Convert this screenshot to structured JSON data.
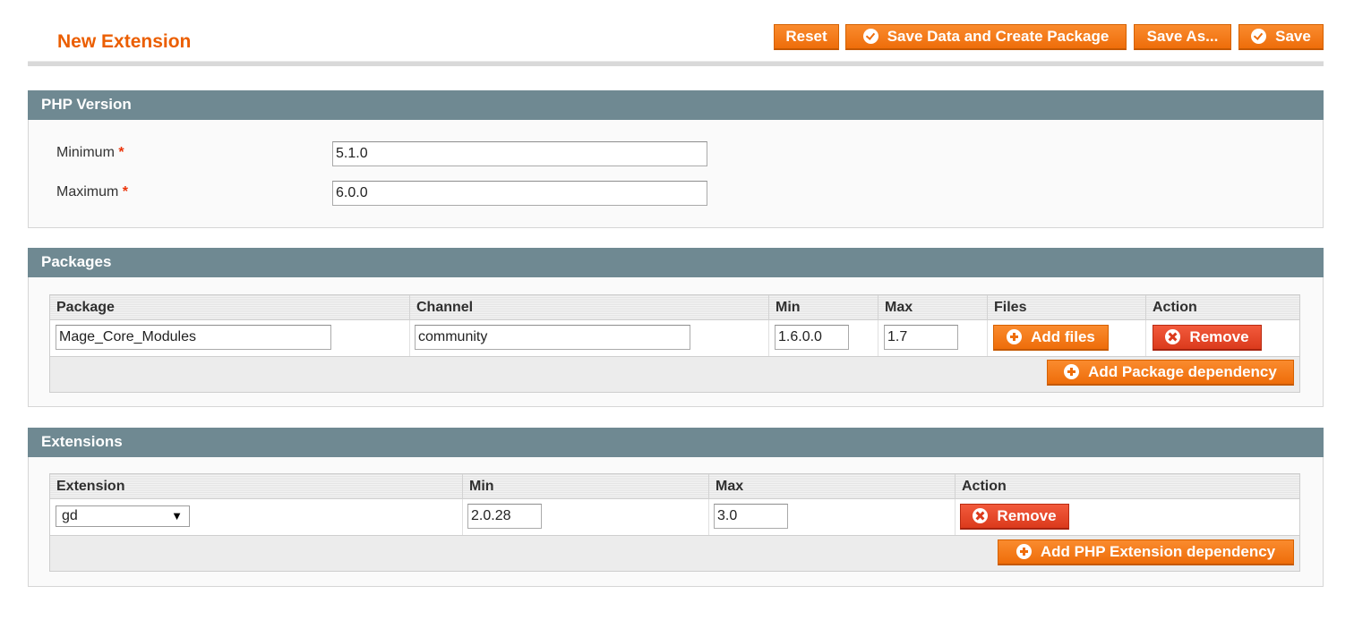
{
  "header": {
    "title": "New Extension",
    "buttons": {
      "reset": "Reset",
      "save_create": "Save Data and Create Package",
      "save_as": "Save As...",
      "save": "Save"
    }
  },
  "php_version": {
    "title": "PHP Version",
    "required_mark": "*",
    "min_label": "Minimum",
    "min_value": "5.1.0",
    "max_label": "Maximum",
    "max_value": "6.0.0"
  },
  "packages": {
    "title": "Packages",
    "columns": [
      "Package",
      "Channel",
      "Min",
      "Max",
      "Files",
      "Action"
    ],
    "rows": [
      {
        "package": "Mage_Core_Modules",
        "channel": "community",
        "min": "1.6.0.0",
        "max": "1.7"
      }
    ],
    "add_files_label": "Add files",
    "remove_label": "Remove",
    "add_dependency_label": "Add Package dependency"
  },
  "extensions": {
    "title": "Extensions",
    "columns": [
      "Extension",
      "Min",
      "Max",
      "Action"
    ],
    "rows": [
      {
        "extension": "gd",
        "min": "2.0.28",
        "max": "3.0"
      }
    ],
    "remove_label": "Remove",
    "add_dependency_label": "Add PHP Extension dependency"
  },
  "icons": {
    "check": "check-circle-icon",
    "plus": "plus-circle-icon",
    "remove": "x-circle-icon",
    "dropdown": "dropdown-arrow-icon"
  },
  "colors": {
    "title": "#eb5e00",
    "button": "#f47b20",
    "remove_button": "#e04a2a",
    "section_header": "#6f8992"
  }
}
